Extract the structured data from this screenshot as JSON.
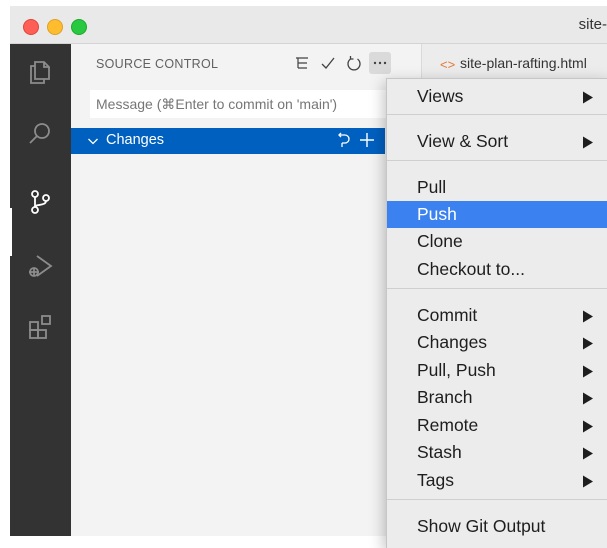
{
  "window": {
    "title_fragment": "site-"
  },
  "activity_bar": {
    "items": [
      {
        "name": "explorer-icon"
      },
      {
        "name": "search-icon"
      },
      {
        "name": "source-control-icon"
      },
      {
        "name": "run-debug-icon"
      },
      {
        "name": "extensions-icon"
      }
    ],
    "active": "source-control-icon"
  },
  "sidebar": {
    "header": "SOURCE CONTROL",
    "actions": [
      "view-as-tree-icon",
      "commit-check-icon",
      "refresh-icon",
      "more-actions-icon"
    ],
    "commit_placeholder": "Message (⌘Enter to commit on 'main')",
    "changes_label": "Changes"
  },
  "editor": {
    "tab_label": "site-plan-rafting.html",
    "tab_icon": "html-code-icon",
    "tab_icon_glyph": "<>"
  },
  "menu": {
    "items": [
      {
        "label": "Views",
        "submenu": true
      },
      {
        "label": "View & Sort",
        "submenu": true
      },
      {
        "label": "Pull",
        "submenu": false
      },
      {
        "label": "Push",
        "submenu": false,
        "highlighted": true
      },
      {
        "label": "Clone",
        "submenu": false
      },
      {
        "label": "Checkout to...",
        "submenu": false
      },
      {
        "label": "Commit",
        "submenu": true
      },
      {
        "label": "Changes",
        "submenu": true
      },
      {
        "label": "Pull, Push",
        "submenu": true
      },
      {
        "label": "Branch",
        "submenu": true
      },
      {
        "label": "Remote",
        "submenu": true
      },
      {
        "label": "Stash",
        "submenu": true
      },
      {
        "label": "Tags",
        "submenu": true
      },
      {
        "label": "Show Git Output",
        "submenu": false
      }
    ]
  },
  "colors": {
    "activity_bar": "#333333",
    "selection": "#0060c0",
    "menu_highlight": "#3b82f0"
  }
}
